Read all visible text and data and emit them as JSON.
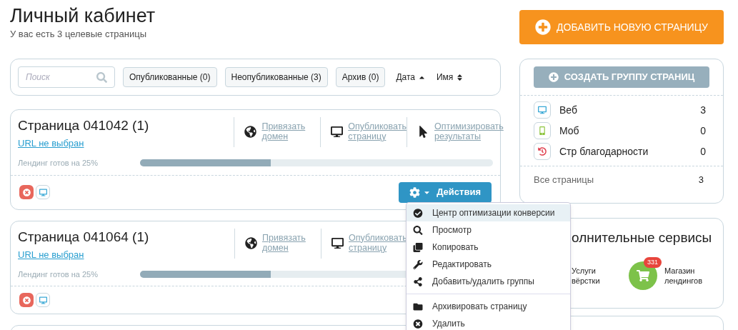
{
  "header": {
    "title": "Личный кабинет",
    "subtitle": "У вас есть 3 целевые страницы",
    "add_button": "ДОБАВИТЬ НОВУЮ СТРАНИЦУ"
  },
  "filters": {
    "search": {
      "placeholder": "Поиск"
    },
    "tabs": [
      {
        "label": "Опубликованные (0)",
        "selected": false
      },
      {
        "label": "Неопубликованные (3)",
        "selected": false
      },
      {
        "label": "Архив (0)",
        "selected": false
      }
    ],
    "sorts": [
      {
        "label": "Дата",
        "kind": "asc"
      },
      {
        "label": "Имя",
        "kind": "both"
      }
    ]
  },
  "pages": [
    {
      "title": "Страница 041042 (1)",
      "url": "URL не выбран",
      "progress_label": "Лендинг готов на 25%",
      "level": 0.37,
      "actions": [
        {
          "kind": "globe",
          "label": "Привязать домен"
        },
        {
          "kind": "monitor",
          "label": "Опубликовать страницу"
        },
        {
          "kind": "cursor",
          "label": "Оптимизировать результаты"
        }
      ],
      "button": "Действия"
    },
    {
      "title": "Страница 041064 (1)",
      "url": "URL не выбран",
      "progress_label": "Лендинг готов на 25%",
      "level": 0.37,
      "actions": [
        {
          "kind": "globe",
          "label": "Привязать домен"
        },
        {
          "kind": "monitor",
          "label": "Опубликовать страницу"
        }
      ]
    }
  ],
  "menu": [
    {
      "kind": "check",
      "label": "Центр оптимизации конверсии",
      "selected": true
    },
    {
      "kind": "search",
      "label": "Просмотр",
      "selected": false
    },
    {
      "kind": "copy",
      "label": "Копировать",
      "selected": false
    },
    {
      "kind": "wrench",
      "label": "Редактировать",
      "selected": false
    },
    {
      "kind": "share",
      "label": "Добавить/удалить группы",
      "selected": false
    },
    {
      "kind": "folder",
      "label": "Архивировать страницу",
      "selected": false
    },
    {
      "kind": "remove",
      "label": "Удалить",
      "selected": false
    }
  ],
  "groups": {
    "button": "СОЗДАТЬ ГРУППУ СТРАНИЦ",
    "items": [
      {
        "kind": "web",
        "label": "Веб",
        "count": "3"
      },
      {
        "kind": "mobile",
        "label": "Моб",
        "count": "0"
      },
      {
        "kind": "thanks",
        "label": "Стр благодарности",
        "count": "0"
      }
    ],
    "total": {
      "label": "Все страницы",
      "count": "3"
    }
  },
  "services": {
    "title": "олнительные сервисы",
    "items": [
      {
        "kind": "layout",
        "label": "Услуги вёрстки"
      },
      {
        "kind": "shop",
        "label": "Магазин лендингов",
        "badge": "331"
      }
    ]
  }
}
